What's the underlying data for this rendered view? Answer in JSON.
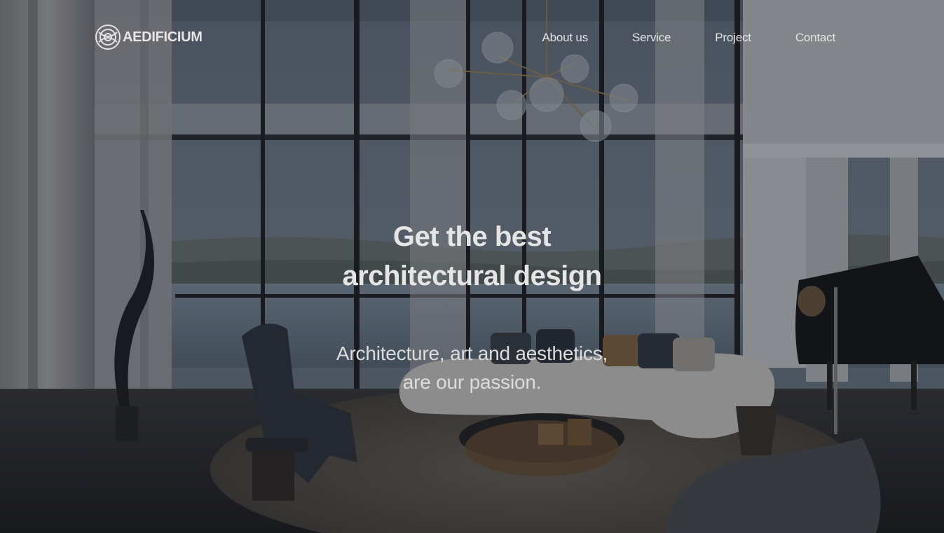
{
  "brand": {
    "name": "AEDIFICIUM",
    "logo_icon": "concentric-rings-logo-icon"
  },
  "nav": {
    "items": [
      {
        "label": "About us"
      },
      {
        "label": "Service"
      },
      {
        "label": "Project"
      },
      {
        "label": "Contact"
      }
    ]
  },
  "hero": {
    "headline_line1": "Get the best",
    "headline_line2": "architectural design",
    "tagline_line1": "Architecture, art and aesthetics,",
    "tagline_line2": "are our passion.",
    "background": "luxury-living-room-photo"
  },
  "colors": {
    "text": "#e5e5e5",
    "overlay": "#12141a"
  }
}
